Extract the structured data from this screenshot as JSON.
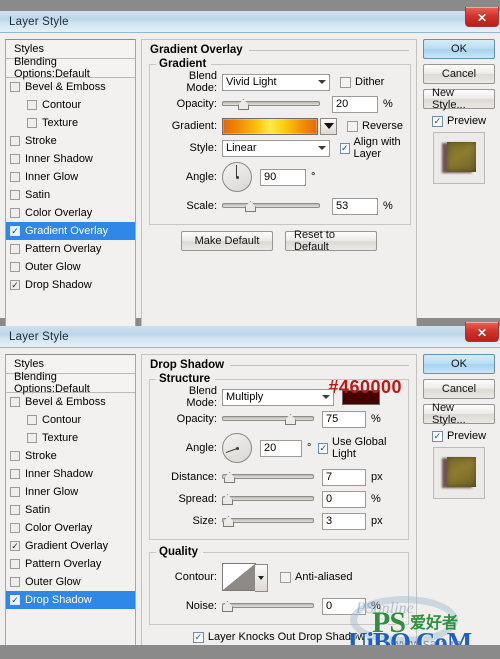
{
  "window_title": "Layer Style",
  "close_glyph": "✕",
  "styles_panel": {
    "header": "Styles",
    "blending": "Blending Options:Default",
    "items": [
      {
        "label": "Bevel & Emboss",
        "checked": false,
        "indent": false
      },
      {
        "label": "Contour",
        "checked": false,
        "indent": true
      },
      {
        "label": "Texture",
        "checked": false,
        "indent": true
      },
      {
        "label": "Stroke",
        "checked": false,
        "indent": false
      },
      {
        "label": "Inner Shadow",
        "checked": false,
        "indent": false
      },
      {
        "label": "Inner Glow",
        "checked": false,
        "indent": false
      },
      {
        "label": "Satin",
        "checked": false,
        "indent": false
      },
      {
        "label": "Color Overlay",
        "checked": false,
        "indent": false
      },
      {
        "label": "Gradient Overlay",
        "checked": true,
        "indent": false
      },
      {
        "label": "Pattern Overlay",
        "checked": false,
        "indent": false
      },
      {
        "label": "Outer Glow",
        "checked": false,
        "indent": false
      },
      {
        "label": "Drop Shadow",
        "checked": true,
        "indent": false
      }
    ]
  },
  "buttons": {
    "ok": "OK",
    "cancel": "Cancel",
    "new_style": "New Style...",
    "preview": "Preview",
    "make_default": "Make Default",
    "reset_default": "Reset to Default"
  },
  "check_glyph": "✓",
  "dialog1": {
    "section_title": "Gradient Overlay",
    "group_title": "Gradient",
    "blend_mode_label": "Blend Mode:",
    "blend_mode_value": "Vivid Light",
    "dither_label": "Dither",
    "dither_checked": false,
    "opacity_label": "Opacity:",
    "opacity_value": "20",
    "opacity_unit": "%",
    "opacity_pct": 20,
    "gradient_label": "Gradient:",
    "gradient_colors": [
      "#e2680d",
      "#fbc20a",
      "#ffe84b",
      "#f29105",
      "#e2680d"
    ],
    "reverse_label": "Reverse",
    "reverse_checked": false,
    "style_label": "Style:",
    "style_value": "Linear",
    "align_label": "Align with Layer",
    "align_checked": true,
    "angle_label": "Angle:",
    "angle_value": "90",
    "angle_unit": "°",
    "scale_label": "Scale:",
    "scale_value": "53",
    "scale_unit": "%",
    "scale_pct": 53
  },
  "dialog2": {
    "section_title": "Drop Shadow",
    "group_title": "Structure",
    "hex_annotation": "#460000",
    "shadow_color": "#460000",
    "blend_mode_label": "Blend Mode:",
    "blend_mode_value": "Multiply",
    "opacity_label": "Opacity:",
    "opacity_value": "75",
    "opacity_unit": "%",
    "opacity_pct": 75,
    "angle_label": "Angle:",
    "angle_value": "20",
    "angle_unit": "°",
    "global_light_label": "Use Global Light",
    "global_light_checked": true,
    "distance_label": "Distance:",
    "distance_value": "7",
    "distance_unit": "px",
    "distance_pct": 4,
    "spread_label": "Spread:",
    "spread_value": "0",
    "spread_unit": "%",
    "spread_pct": 0,
    "size_label": "Size:",
    "size_value": "3",
    "size_unit": "px",
    "size_pct": 2,
    "quality_title": "Quality",
    "contour_label": "Contour:",
    "antialiased_label": "Anti-aliased",
    "antialiased_checked": false,
    "noise_label": "Noise:",
    "noise_value": "0",
    "noise_unit": "%",
    "noise_pct": 0,
    "knockout_label": "Layer Knocks Out Drop Shadow",
    "knockout_checked": true
  },
  "watermark": {
    "ps": "PS",
    "cn": "爱好者",
    "online": "PSonline",
    "site": "UiBQ.CoM",
    "www": "www.sa z m"
  }
}
